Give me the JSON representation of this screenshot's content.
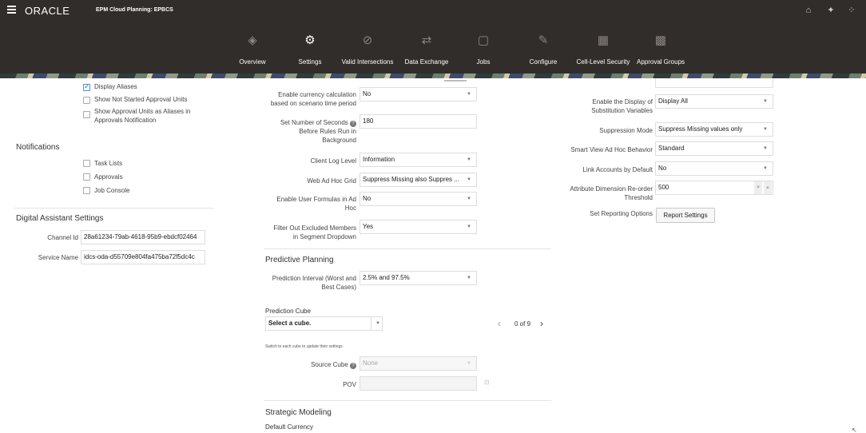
{
  "header": {
    "logo": "ORACLE",
    "app_title": "EPM Cloud Planning: EPBCS",
    "icons": [
      "home-icon",
      "accessibility-icon",
      "navigator-icon"
    ]
  },
  "nav": [
    {
      "label": "Overview",
      "icon": "overview-icon"
    },
    {
      "label": "Settings",
      "icon": "settings-icon",
      "active": true
    },
    {
      "label": "Valid Intersections",
      "icon": "valid-intersections-icon"
    },
    {
      "label": "Data Exchange",
      "icon": "data-exchange-icon"
    },
    {
      "label": "Jobs",
      "icon": "jobs-icon"
    },
    {
      "label": "Configure",
      "icon": "configure-icon"
    },
    {
      "label": "Cell-Level Security",
      "icon": "cell-level-security-icon"
    },
    {
      "label": "Approval Groups",
      "icon": "approval-groups-icon"
    }
  ],
  "left": {
    "approvals": [
      {
        "label": "Display Aliases",
        "checked": true
      },
      {
        "label": "Show Not Started Approval Units",
        "checked": false
      },
      {
        "label": "Show Approval Units as Aliases in",
        "label2": "Approvals Notification",
        "checked": false
      }
    ],
    "notifications_title": "Notifications",
    "notifications": [
      {
        "label": "Task Lists"
      },
      {
        "label": "Approvals"
      },
      {
        "label": "Job Console"
      }
    ],
    "assistant_title": "Digital Assistant Settings",
    "channel_id_label": "Channel Id",
    "channel_id_value": "28a61234-79ab-4618-95b9-ebdcf02464",
    "service_name_label": "Service Name",
    "service_name_value": "idcs-oda-d55709e804fa475ba72f5dc4c"
  },
  "middle": {
    "currency_label_1": "Enable currency calculation",
    "currency_label_2": "based on scenario time period",
    "currency_value": "No",
    "seconds_label_1": "Set Number of Seconds",
    "seconds_label_2": "Before Rules Run in",
    "seconds_label_3": "Background",
    "seconds_value": "180",
    "log_label": "Client Log Level",
    "log_value": "Information",
    "adhoc_label": "Web Ad Hoc Grid",
    "adhoc_value": "Suppress Missing also Suppres ...",
    "formulas_label_1": "Enable User Formulas in Ad",
    "formulas_label_2": "Hoc",
    "formulas_value": "No",
    "filter_label_1": "Filter Out Excluded Members",
    "filter_label_2": "in Segment Dropdown",
    "filter_value": "Yes",
    "predictive_title": "Predictive Planning",
    "interval_label_1": "Prediction Interval (Worst and",
    "interval_label_2": "Best Cases)",
    "interval_value": "2.5% and 97.5%",
    "cube_label": "Prediction Cube",
    "cube_value": "Select a cube.",
    "pager": "0 of 9",
    "switch_hint": "Switch to each cube to update their settings",
    "source_cube_label": "Source Cube",
    "source_cube_value": "None",
    "pov_label": "POV",
    "strategic_title": "Strategic Modeling",
    "default_currency_label": "Default Currency"
  },
  "right": {
    "subst_label_1": "Enable the Display of",
    "subst_label_2": "Substitution Variables",
    "subst_value": "Display All",
    "suppression_label": "Suppression Mode",
    "suppression_value": "Suppress Missing values only",
    "smartview_label": "Smart View Ad Hoc Behavior",
    "smartview_value": "Standard",
    "link_label": "Link Accounts by Default",
    "link_value": "No",
    "reorder_label_1": "Attribute Dimension Re-order",
    "reorder_label_2": "Threshold",
    "reorder_value": "500",
    "reporting_label": "Set Reporting Options",
    "report_button": "Report Settings"
  }
}
